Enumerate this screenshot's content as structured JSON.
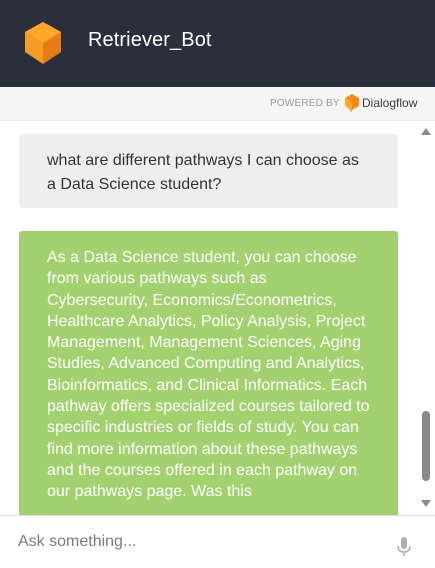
{
  "header": {
    "title": "Retriever_Bot",
    "logo_icon": "dialogflow-cube-icon",
    "background": "#2b2f3b"
  },
  "powered_by": {
    "label": "POWERED BY",
    "brand": "Dialogflow",
    "brand_icon": "dialogflow-icon",
    "brand_color": "#ff9800"
  },
  "messages": [
    {
      "sender": "user",
      "text": "what are different pathways I can choose as a Data Science student?",
      "color": "#eeeeee"
    },
    {
      "sender": "bot",
      "text": "As a Data Science student, you can choose from various pathways such as Cybersecurity, Economics/Econometrics, Healthcare Analytics, Policy Analysis, Project Management, Management Sciences, Aging Studies, Advanced Computing and Analytics, Bioinformatics, and Clinical Informatics. Each pathway offers specialized courses tailored to specific industries or fields of study. You can find more information about these pathways and the courses offered in each pathway on our pathways page. Was this",
      "color": "#a3d16f"
    }
  ],
  "input": {
    "placeholder": "Ask something...",
    "value": "",
    "mic_icon": "microphone-icon"
  }
}
